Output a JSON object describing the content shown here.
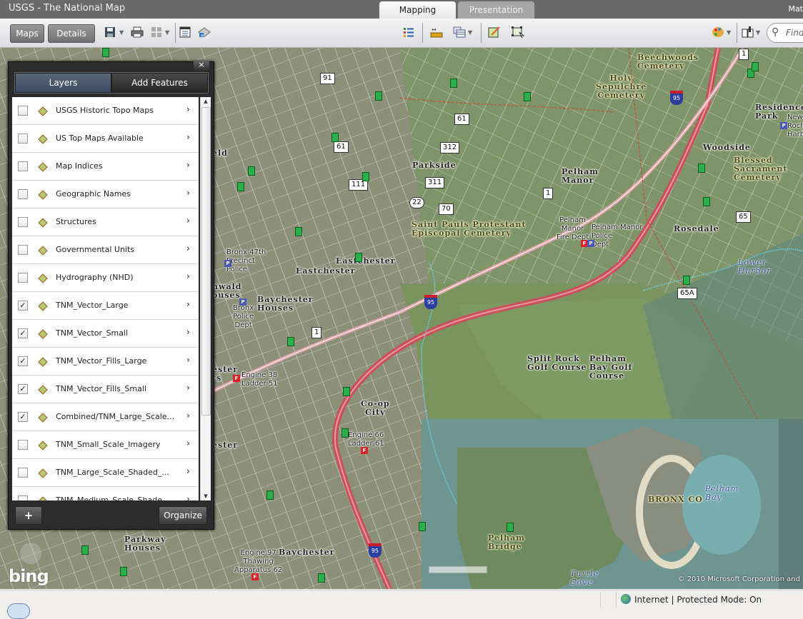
{
  "window": {
    "title": "USGS - The National Map",
    "user": "Mat"
  },
  "tabs": [
    {
      "label": "Mapping",
      "active": true
    },
    {
      "label": "Presentation",
      "active": false
    }
  ],
  "toolbar": {
    "maps_label": "Maps",
    "details_label": "Details",
    "find_placeholder": "Find",
    "icons": [
      "save-icon",
      "print-icon",
      "grid-icon",
      "legend-icon",
      "add-layer-icon",
      "list-icon",
      "measure-icon",
      "table-icon",
      "draw-icon",
      "select-icon",
      "palette-icon",
      "book-icon",
      "search-icon"
    ]
  },
  "panel": {
    "tabs": [
      {
        "label": "Layers",
        "active": true
      },
      {
        "label": "Add Features",
        "active": false
      }
    ],
    "close_label": "×",
    "layers": [
      {
        "label": "USGS Historic Topo Maps",
        "checked": false
      },
      {
        "label": "US Top Maps Available",
        "checked": false
      },
      {
        "label": "Map Indices",
        "checked": false
      },
      {
        "label": "Geographic Names",
        "checked": false
      },
      {
        "label": "Structures",
        "checked": false
      },
      {
        "label": "Governmental Units",
        "checked": false
      },
      {
        "label": "Hydrography (NHD)",
        "checked": false
      },
      {
        "label": "TNM_Vector_Large",
        "checked": true
      },
      {
        "label": "TNM_Vector_Small",
        "checked": true
      },
      {
        "label": "TNM_Vector_Fills_Large",
        "checked": true
      },
      {
        "label": "TNM_Vector_Fills_Small",
        "checked": true
      },
      {
        "label": "Combined/TNM_Large_Scale...",
        "checked": true
      },
      {
        "label": "TNM_Small_Scale_Imagery",
        "checked": false
      },
      {
        "label": "TNM_Large_Scale_Shaded_...",
        "checked": false
      },
      {
        "label": "TNM_Medium_Scale_Shade...",
        "checked": false
      }
    ],
    "add_label": "+",
    "organize_label": "Organize"
  },
  "map": {
    "labels": {
      "beechwoods": "Beechwoods\nCemetery",
      "holy": "Holy\nSepulchre\nCemetery",
      "residence": "Residence\nPark",
      "new_roch": "New\nRoch\nHarb",
      "woodside": "Woodside",
      "blessed": "Blessed\nSacrament\nCemetery",
      "parkside": "Parkside",
      "pelham_manor": "Pelham\nManor",
      "pm_fire": "Pelham\nManor\nFire Dept",
      "pm_police": "Pelham Manor\nPolice\nDept",
      "saint_pauls": "Saint Pauls Protestant\nEpiscopal Cemetery",
      "rosedale": "Rosedale",
      "lower_harbor": "Lower\nHarbor",
      "bronx47": "Bronx 47th\nPrecinct\nPolice",
      "eastchester1": "Eastchester",
      "eastchester2": "Eastchester",
      "edenwald": "nwald\nouses",
      "baychester_houses": "Baychester\nHouses",
      "bronx_police": "Bronx\nPolice\nDept",
      "field": "eld",
      "engine38": "Engine 38\nLadder 51",
      "ester": "ester\nts",
      "split_rock": "Split Rock\nGolf Course",
      "pelham_bay_golf": "Pelham\nBay Golf\nCourse",
      "coop": "Co-op\nCity",
      "engine66": "Engine 66\nLadder 61",
      "ester2": "ester",
      "parkway": "Parkway\nHouses",
      "engine97": "Engine 97\nThawing\nApparatus 62",
      "baychester": "Baychester",
      "pelham_bridge": "Pelham\nBridge",
      "bronx_co": "BRONX CO",
      "pelham_bay": "Pelham\nBay",
      "turtle_cove": "Turtle\nCove"
    },
    "shields": {
      "r91": "91",
      "r61a": "61",
      "r61b": "61",
      "r312": "312",
      "r111": "111",
      "r311": "311",
      "r22": "22",
      "r70": "70",
      "us1a": "1",
      "us1b": "1",
      "us1c": "1",
      "r65": "65",
      "r65a": "65A",
      "i95a": "95",
      "i95b": "95",
      "i95c": "95"
    },
    "copyright": "© 2010 Microsoft Corporation and",
    "bing_logo": "bing"
  },
  "statusbar": {
    "zone": "Internet | Protected Mode: On"
  }
}
